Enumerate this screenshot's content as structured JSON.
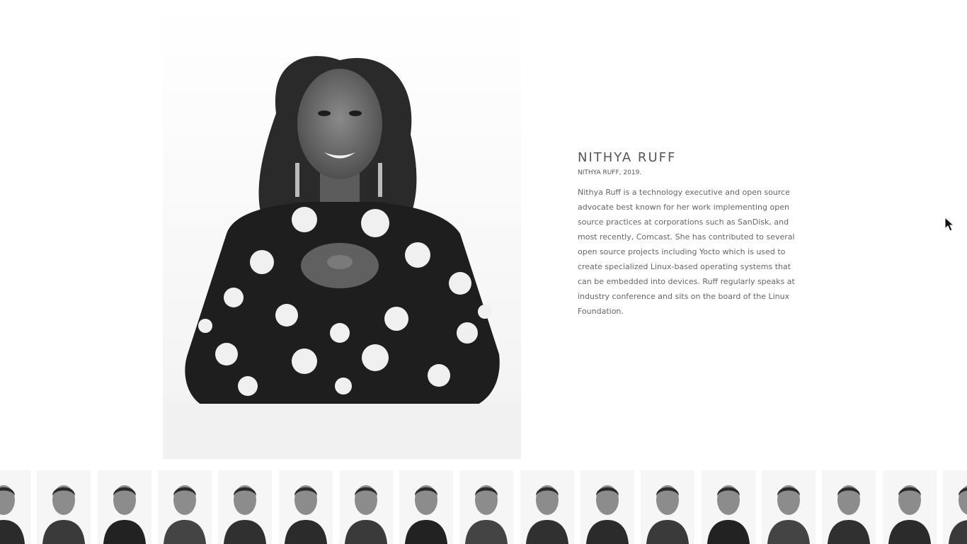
{
  "featured": {
    "name": "NITHYA RUFF",
    "caption": "NITHYA RUFF, 2019.",
    "bio": "Nithya Ruff is a technology executive and open source advocate best known for her work implementing open source practices at corporations such as SanDisk, and most recently, Comcast. She has contributed to several open source projects including Yocto which is used to create specialized Linux-based operating systems that can be embedded into devices. Ruff regularly speaks at industry conference and sits on the board of the Linux Foundation.",
    "photo": "portrait-photo"
  },
  "colors": {
    "background": "#ffffff",
    "name_text": "#555555",
    "body_text": "#666666"
  },
  "thumbnails": [
    {
      "id": "portrait-1",
      "icon": "portrait-photo"
    },
    {
      "id": "portrait-2",
      "icon": "portrait-photo"
    },
    {
      "id": "portrait-3",
      "icon": "portrait-photo"
    },
    {
      "id": "portrait-4",
      "icon": "portrait-photo"
    },
    {
      "id": "portrait-5",
      "icon": "portrait-photo"
    },
    {
      "id": "portrait-6",
      "icon": "portrait-photo"
    },
    {
      "id": "portrait-7",
      "icon": "portrait-photo"
    },
    {
      "id": "portrait-8",
      "icon": "portrait-photo"
    },
    {
      "id": "portrait-9",
      "icon": "portrait-photo"
    },
    {
      "id": "portrait-10",
      "icon": "portrait-photo"
    },
    {
      "id": "portrait-11",
      "icon": "portrait-photo"
    },
    {
      "id": "portrait-12",
      "icon": "portrait-photo"
    },
    {
      "id": "portrait-13",
      "icon": "portrait-photo"
    },
    {
      "id": "portrait-14",
      "icon": "portrait-photo"
    },
    {
      "id": "portrait-15",
      "icon": "portrait-photo"
    },
    {
      "id": "portrait-16",
      "icon": "portrait-photo"
    },
    {
      "id": "portrait-17",
      "icon": "portrait-photo"
    }
  ]
}
